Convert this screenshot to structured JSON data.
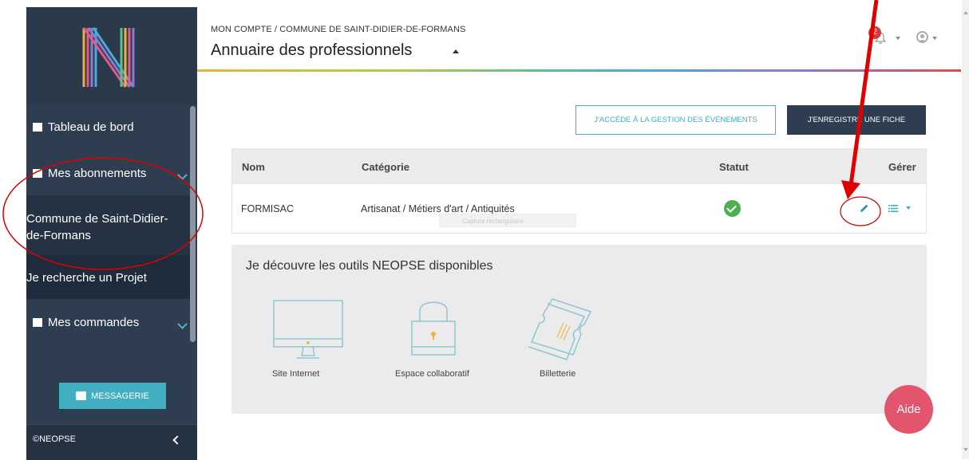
{
  "header": {
    "breadcrumb": "MON COMPTE / COMMUNE DE SAINT-DIDIER-DE-FORMANS",
    "title": "Annuaire des professionnels",
    "notification_count": "2"
  },
  "sidebar": {
    "items": [
      {
        "label": "Tableau de bord",
        "icon": "dashboard-icon"
      },
      {
        "label": "Mes abonnements",
        "icon": "subscriptions-icon"
      },
      {
        "label": "Commune de Saint-Didier-de-Formans"
      },
      {
        "label": "Je recherche un Projet"
      },
      {
        "label": "Mes commandes",
        "icon": "orders-icon"
      }
    ],
    "message_button": "MESSAGERIE",
    "footer": "©NEOPSE"
  },
  "actions": {
    "events_button": "J'ACCÈDE À LA GESTION DES ÉVÉNEMENTS",
    "register_button": "J'ENREGISTRE UNE FICHE"
  },
  "table": {
    "columns": [
      "Nom",
      "Catégorie",
      "Statut",
      "Gérer"
    ],
    "rows": [
      {
        "name": "FORMISAC",
        "category": "Artisanat / Métiers d'art / Antiquités",
        "status": "validated"
      }
    ]
  },
  "tools": {
    "title": "Je découvre les outils NEOPSE disponibles",
    "items": [
      {
        "label": "Site Internet",
        "icon": "monitor-icon"
      },
      {
        "label": "Espace collaboratif",
        "icon": "padlock-icon"
      },
      {
        "label": "Billetterie",
        "icon": "tickets-icon"
      }
    ]
  },
  "ghost_tooltip": "Capture rectangulaire",
  "help_button": "Aide",
  "colors": {
    "sidebar": "#2e3e50",
    "accent": "#41aec1",
    "annotation": "#e00000",
    "help": "#e2556c"
  }
}
